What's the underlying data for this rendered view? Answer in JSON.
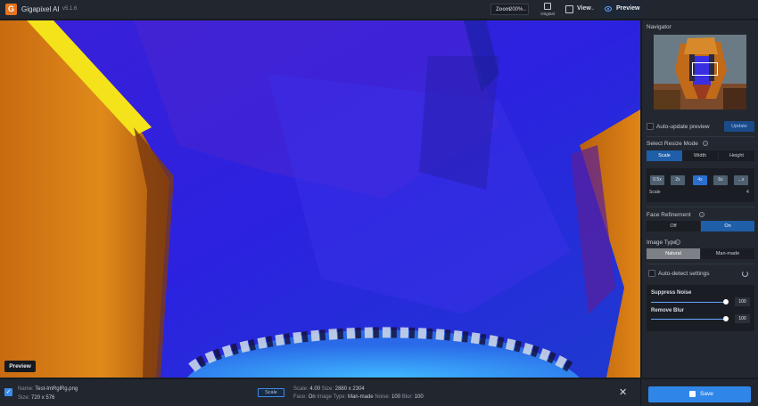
{
  "app": {
    "title": "Gigapixel AI",
    "version": "v5.1.6",
    "logo_letter": "G"
  },
  "toolbar": {
    "zoom_label": "Zoom",
    "zoom_value": "200%",
    "zoom_caret": "⌄",
    "original_label": "Original",
    "view_label": "View",
    "view_caret": "⌄",
    "preview_label": "Preview",
    "icons": [
      "original-icon",
      "view-icon",
      "eye-icon"
    ]
  },
  "viewport": {
    "preview_badge": "Preview"
  },
  "panel": {
    "navigator_title": "Navigator",
    "auto_update_label": "Auto-update preview",
    "auto_update_checked": false,
    "update_button": "Update",
    "resize_mode_title": "Select Resize Mode",
    "resize_modes": [
      "Scale",
      "Width",
      "Height"
    ],
    "resize_mode_selected": "Scale",
    "scale_options": [
      "0.5x",
      "2x",
      "4x",
      "6x",
      "...x"
    ],
    "scale_selected": "4x",
    "scale_label": "Scale",
    "scale_value": "4",
    "face_refinement_title": "Face Refinement",
    "face_refinement_options": [
      "Off",
      "On"
    ],
    "face_refinement_selected": "On",
    "image_type_title": "Image Type",
    "image_type_options": [
      "Natural",
      "Man-made"
    ],
    "image_type_selected": "Natural",
    "auto_detect_label": "Auto-detect settings",
    "auto_detect_checked": false,
    "suppress_noise_label": "Suppress Noise",
    "suppress_noise_value": "100",
    "remove_blur_label": "Remove Blur",
    "remove_blur_value": "100",
    "help_glyph": "?"
  },
  "bottom": {
    "check_glyph": "✓",
    "name_label": "Name:",
    "name_value": "Test-ImRglRg.png",
    "size_label": "Size:",
    "size_value": "720 x 576",
    "mode_chip": "Scale",
    "scale_label": "Scale:",
    "scale_value": "4.00",
    "out_size_label": "Size:",
    "out_size_value": "2880 x 2304",
    "face_label": "Face:",
    "face_value": "On",
    "image_type_label": "Image Type:",
    "image_type_value": "Man-made",
    "noise_label": "Noise:",
    "noise_value": "100",
    "blur_label": "Blur:",
    "blur_value": "100",
    "close_glyph": "✕",
    "save_label": "Save"
  },
  "colors": {
    "accent": "#2f86e8",
    "panel_bg": "#232830",
    "active_segment": "#1f5ea8",
    "natural_segment": "#7d8187"
  }
}
